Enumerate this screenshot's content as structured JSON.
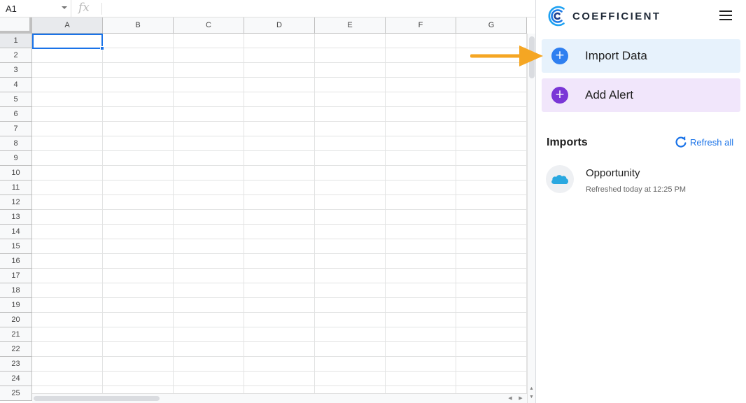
{
  "spreadsheet": {
    "name_box": "A1",
    "formula_icon": "fx",
    "formula_value": "",
    "columns": [
      "A",
      "B",
      "C",
      "D",
      "E",
      "F",
      "G"
    ],
    "rows": [
      "1",
      "2",
      "3",
      "4",
      "5",
      "6",
      "7",
      "8",
      "9",
      "10",
      "11",
      "12",
      "13",
      "14",
      "15",
      "16",
      "17",
      "18",
      "19",
      "20",
      "21",
      "22",
      "23",
      "24",
      "25"
    ],
    "active_cell": "A1",
    "selection_color": "#1a73e8"
  },
  "sidebar": {
    "brand": {
      "name": "COEFFICIENT",
      "logo_icon": "coefficient-logo"
    },
    "menu_icon": "hamburger-menu-icon",
    "actions": [
      {
        "label": "Import Data",
        "icon": "plus-circle-icon",
        "color": "#2f7ff0",
        "background": "#e7f2fc"
      },
      {
        "label": "Add Alert",
        "icon": "plus-circle-icon",
        "color": "#7a36d6",
        "background": "#f1e6fb"
      }
    ],
    "imports_section": {
      "heading": "Imports",
      "refresh_label": "Refresh all",
      "refresh_icon": "refresh-icon",
      "items": [
        {
          "name": "Opportunity",
          "status": "Refreshed today at 12:25 PM",
          "source_icon": "salesforce-icon"
        }
      ]
    }
  },
  "annotation": {
    "icon": "orange-arrow",
    "color": "#f5a623"
  }
}
